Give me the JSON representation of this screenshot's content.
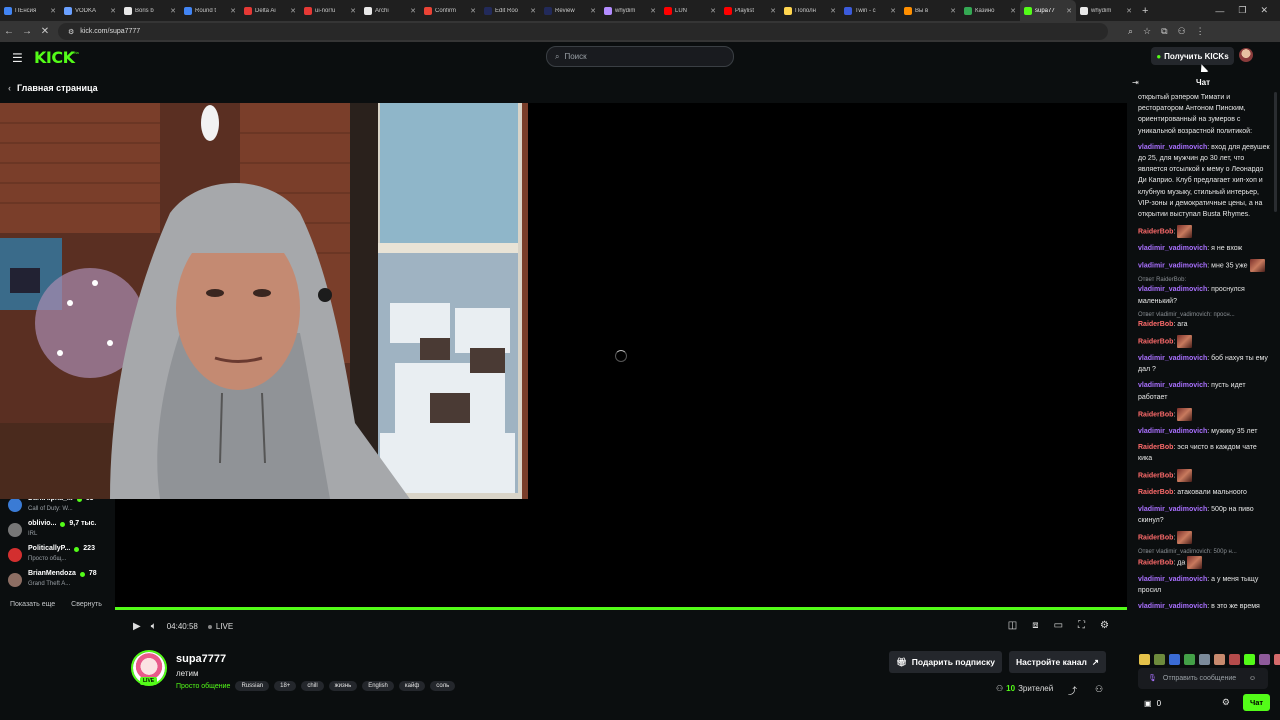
{
  "browser": {
    "tabs": [
      {
        "title": "ПЕнсия",
        "color": "#4285f4"
      },
      {
        "title": "VODKA",
        "color": "#6aa0ff"
      },
      {
        "title": "Boris b",
        "color": "#e8e8e8"
      },
      {
        "title": "Round t",
        "color": "#4285f4"
      },
      {
        "title": "Delta Ai",
        "color": "#e53935"
      },
      {
        "title": "ui-nor!u",
        "color": "#e53935"
      },
      {
        "title": "Archi",
        "color": "#e8e8e8"
      },
      {
        "title": "Confirm",
        "color": "#ea4335"
      },
      {
        "title": "Edit Roo",
        "color": "#222a5a"
      },
      {
        "title": "Review",
        "color": "#222a5a"
      },
      {
        "title": "whydim",
        "color": "#b38cff"
      },
      {
        "title": "LUN",
        "color": "#ff0000"
      },
      {
        "title": "Playlist",
        "color": "#ff0000"
      },
      {
        "title": "Пополн",
        "color": "#ffd54f"
      },
      {
        "title": "Twin - c",
        "color": "#3b5bdb"
      },
      {
        "title": "Вы в",
        "color": "#ff8f00"
      },
      {
        "title": "Казино",
        "color": "#34a853"
      },
      {
        "title": "supa77",
        "color": "#53fc18",
        "active": true
      },
      {
        "title": "whydim",
        "color": "#e8e8e8"
      }
    ],
    "url": "kick.com/supa7777"
  },
  "header": {
    "logo": "KICK",
    "logo_sup": "beta",
    "search_placeholder": "Поиск",
    "get_kicks": "Получить KICKs"
  },
  "sidebar": {
    "back_label": "Главная страница",
    "channels": [
      {
        "name": "DarkAlpha_...",
        "viewers": "63",
        "category": "Call of Duty: W...",
        "color": "#3a7bd5"
      },
      {
        "name": "oblivio...",
        "viewers": "9,7 тыс.",
        "category": "IRL",
        "color": "#777"
      },
      {
        "name": "PoliticallyP...",
        "viewers": "223",
        "category": "Просто общ...",
        "color": "#d32f2f"
      },
      {
        "name": "BrianMendoza",
        "viewers": "78",
        "category": "Grand Theft A...",
        "color": "#8d6e63"
      }
    ],
    "show_more": "Показать еще",
    "collapse": "Свернуть"
  },
  "player": {
    "time": "04:40:58",
    "live": "LIVE"
  },
  "channel": {
    "name": "supa7777",
    "title": "летим",
    "category": "Просто общение",
    "tags": [
      "Russian",
      "18+",
      "chill",
      "жизнь",
      "English",
      "кайф",
      "соль"
    ],
    "live_badge": "LIVE",
    "gift_sub": "Подарить подписку",
    "setup_channel": "Настройте канал",
    "viewers_count": "10",
    "viewers_label": "Зрителей"
  },
  "chat": {
    "title": "Чат",
    "messages": [
      {
        "user": "",
        "text": "открытый рэпером Тимати и ресторатором Антоном Пинским, ориентированный на зумеров с уникальной возрастной политикой:"
      },
      {
        "user": "vladimir_vadimovich",
        "text": ": вход для девушек до 25, для мужчин до 30 лет, что является отсылкой к мему о Леонардо Ди Каприо. Клуб предлагает хип-хоп и клубную музыку, стильный интерьер, VIP-зоны и демократичные цены, а на открытии выступал Busta Rhymes."
      },
      {
        "user": "RaiderBob",
        "text": ":",
        "emote": true
      },
      {
        "user": "vladimir_vadimovich",
        "text": ": я не вхож"
      },
      {
        "user": "vladimir_vadimovich",
        "text": ": мне 35 уже",
        "emote": true
      },
      {
        "reply": "Ответ RaiderBob:",
        "user": "vladimir_vadimovich",
        "text": ": проснулся маленький?"
      },
      {
        "reply": "Ответ vladimir_vadimovich: просн...",
        "user": "RaiderBob",
        "text": ": ага"
      },
      {
        "user": "RaiderBob",
        "text": ":",
        "emote": true
      },
      {
        "user": "vladimir_vadimovich",
        "text": ": боб нахуя ты ему дал ?"
      },
      {
        "user": "vladimir_vadimovich",
        "text": ": пусть идет работает"
      },
      {
        "user": "RaiderBob",
        "text": ":",
        "emote": true
      },
      {
        "user": "vladimir_vadimovich",
        "text": ": мужику 35 лет"
      },
      {
        "user": "RaiderBob",
        "text": ": эся чисто в каждом чате кика"
      },
      {
        "user": "RaiderBob",
        "text": ":",
        "emote": true
      },
      {
        "user": "RaiderBob",
        "text": ": атаковали мальноого"
      },
      {
        "user": "vladimir_vadimovich",
        "text": ": 500р на пиво скинул?"
      },
      {
        "user": "RaiderBob",
        "text": ":",
        "emote": true
      },
      {
        "reply": "Ответ vladimir_vadimovich: 500р н...",
        "user": "RaiderBob",
        "text": ": да",
        "emote": true
      },
      {
        "user": "vladimir_vadimovich",
        "text": ": а у меня тыщу просил"
      },
      {
        "user": "vladimir_vadimovich",
        "text": ": в это же время"
      }
    ],
    "input_placeholder": "Отправить сообщение",
    "kicks_balance": "0",
    "send_button": "Чат"
  },
  "colors": {
    "brand_green": "#53fc18",
    "username_purple": "#a970ff",
    "username_red": "#ff6b6b",
    "background": "#0b0e0f"
  }
}
